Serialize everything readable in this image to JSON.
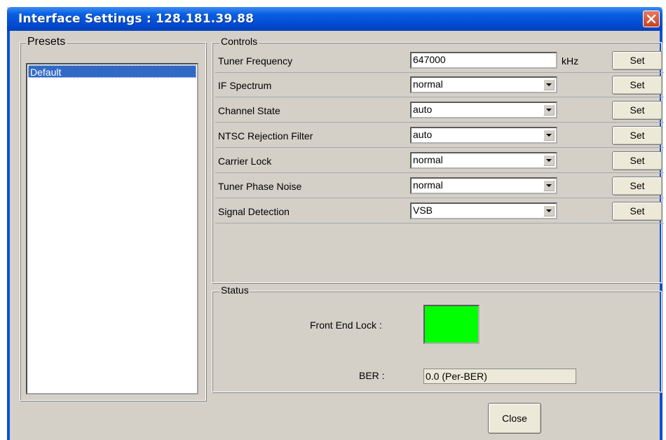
{
  "window": {
    "title": "Interface Settings : 128.181.39.88"
  },
  "presets": {
    "legend": "Presets",
    "items": [
      "Default"
    ],
    "selected": "Default"
  },
  "controls": {
    "legend": "Controls",
    "rows": [
      {
        "label": "Tuner Frequency",
        "value": "647000",
        "unit": "kHz",
        "button": "Set",
        "type": "text"
      },
      {
        "label": "IF Spectrum",
        "value": "normal",
        "button": "Set",
        "type": "select"
      },
      {
        "label": "Channel State",
        "value": "auto",
        "button": "Set",
        "type": "select"
      },
      {
        "label": "NTSC Rejection Filter",
        "value": "auto",
        "button": "Set",
        "type": "select"
      },
      {
        "label": "Carrier Lock",
        "value": "normal",
        "button": "Set",
        "type": "select"
      },
      {
        "label": "Tuner Phase Noise",
        "value": "normal",
        "button": "Set",
        "type": "select"
      },
      {
        "label": "Signal Detection",
        "value": "VSB",
        "button": "Set",
        "type": "select"
      }
    ]
  },
  "status": {
    "legend": "Status",
    "front_end_lock_label": "Front End Lock :",
    "front_end_lock_color": "#00ff00",
    "ber_label": "BER :",
    "ber_value": "0.0 (Per-BER)"
  },
  "footer": {
    "close_label": "Close"
  },
  "colors": {
    "title_bar": "#0048d0",
    "selection": "#316ac5",
    "dialog_bg": "#d4d0c8"
  }
}
